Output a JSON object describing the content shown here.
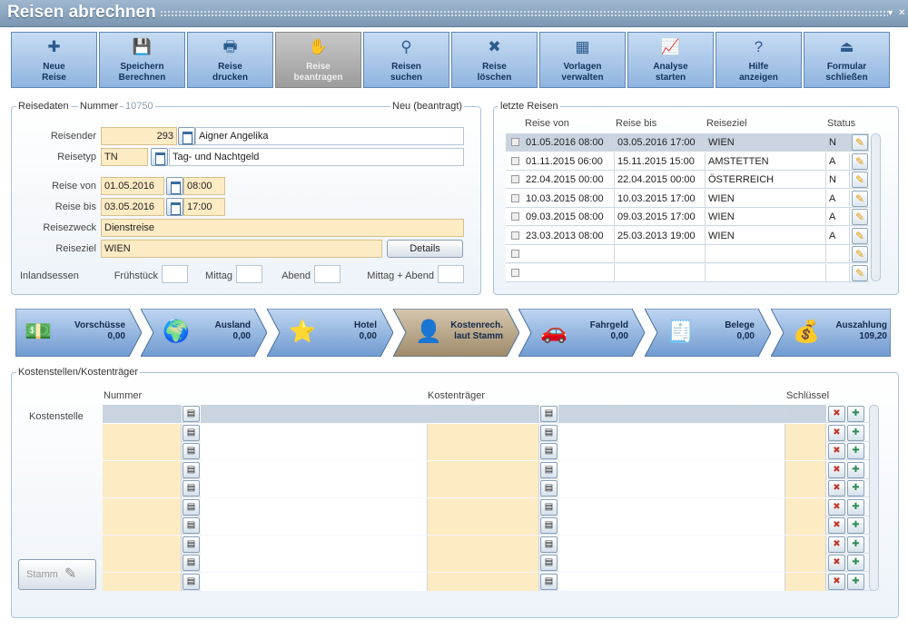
{
  "window": {
    "title": "Reisen abrechnen",
    "min_icon": "minimize-icon",
    "close_icon": "close-icon"
  },
  "toolbar": [
    {
      "label": "Neue\nReise",
      "icon": "new-trip-icon",
      "glyph": "✚",
      "disabled": false
    },
    {
      "label": "Speichern\nBerechnen",
      "icon": "save-icon",
      "glyph": "💾",
      "disabled": false
    },
    {
      "label": "Reise\ndrucken",
      "icon": "printer-icon",
      "glyph": "🖶",
      "disabled": false
    },
    {
      "label": "Reise\nbeantragen",
      "icon": "hand-icon",
      "glyph": "✋",
      "disabled": true
    },
    {
      "label": "Reisen\nsuchen",
      "icon": "binoculars-icon",
      "glyph": "⚲",
      "disabled": false
    },
    {
      "label": "Reise\nlöschen",
      "icon": "delete-icon",
      "glyph": "✖",
      "disabled": false
    },
    {
      "label": "Vorlagen\nverwalten",
      "icon": "templates-icon",
      "glyph": "▦",
      "disabled": false
    },
    {
      "label": "Analyse\nstarten",
      "icon": "analysis-icon",
      "glyph": "📈",
      "disabled": false
    },
    {
      "label": "Hilfe\nanzeigen",
      "icon": "help-icon",
      "glyph": "?",
      "disabled": false
    },
    {
      "label": "Formular\nschließen",
      "icon": "exit-icon",
      "glyph": "⏏",
      "disabled": false
    }
  ],
  "reisedaten": {
    "legend": "Reisedaten",
    "nummer_label": "Nummer",
    "nummer": "10750",
    "status": "Neu (beantragt)",
    "reisender_label": "Reisender",
    "reisender_nr": "293",
    "reisender_name": "Aigner Angelika",
    "reisetyp_label": "Reisetyp",
    "reisetyp_code": "TN",
    "reisetyp_name": "Tag- und Nachtgeld",
    "von_label": "Reise von",
    "von_datum": "01.05.2016",
    "von_zeit": "08:00",
    "bis_label": "Reise bis",
    "bis_datum": "03.05.2016",
    "bis_zeit": "17:00",
    "zweck_label": "Reisezweck",
    "zweck": "Dienstreise",
    "ziel_label": "Reiseziel",
    "ziel": "WIEN",
    "details": "Details",
    "essen_label": "Inlandsessen",
    "fruehstueck": "Frühstück",
    "mittag": "Mittag",
    "abend": "Abend",
    "mittag_abend": "Mittag + Abend"
  },
  "letzte_reisen": {
    "legend": "letzte Reisen",
    "headers": [
      "Reise von",
      "Reise bis",
      "Reiseziel",
      "Status"
    ],
    "rows": [
      {
        "von": "01.05.2016 08:00",
        "bis": "03.05.2016 17:00",
        "ziel": "WIEN",
        "status": "N"
      },
      {
        "von": "01.11.2015 06:00",
        "bis": "15.11.2015 15:00",
        "ziel": "AMSTETTEN",
        "status": "A"
      },
      {
        "von": "22.04.2015 00:00",
        "bis": "22.04.2015 00:00",
        "ziel": "ÖSTERREICH",
        "status": "N"
      },
      {
        "von": "10.03.2015 08:00",
        "bis": "10.03.2015 17:00",
        "ziel": "WIEN",
        "status": "A"
      },
      {
        "von": "09.03.2015 08:00",
        "bis": "09.03.2015 17:00",
        "ziel": "WIEN",
        "status": "A"
      },
      {
        "von": "23.03.2013 08:00",
        "bis": "25.03.2013 19:00",
        "ziel": "WIEN",
        "status": "A"
      },
      {
        "von": "",
        "bis": "",
        "ziel": "",
        "status": ""
      },
      {
        "von": "",
        "bis": "",
        "ziel": "",
        "status": ""
      }
    ]
  },
  "steps": [
    {
      "title": "Vorschüsse",
      "value": "0,00",
      "icon": "cash-icon",
      "glyph": "💵",
      "active": false
    },
    {
      "title": "Ausland",
      "value": "0,00",
      "icon": "globe-icon",
      "glyph": "🌍",
      "active": false
    },
    {
      "title": "Hotel",
      "value": "0,00",
      "icon": "hotel-stars-icon",
      "glyph": "⭐",
      "active": false
    },
    {
      "title": "Kostenrech.\nlaut Stamm",
      "value": "",
      "icon": "person-icon",
      "glyph": "👤",
      "active": true
    },
    {
      "title": "Fahrgeld",
      "value": "0,00",
      "icon": "car-icon",
      "glyph": "🚗",
      "active": false
    },
    {
      "title": "Belege",
      "value": "0,00",
      "icon": "receipt-icon",
      "glyph": "🧾",
      "active": false
    },
    {
      "title": "Auszahlung",
      "value": "109,20",
      "icon": "payout-icon",
      "glyph": "💰",
      "active": false
    }
  ],
  "kosten": {
    "legend": "Kostenstellen/Kostenträger",
    "nummer": "Nummer",
    "kostentraeger": "Kostenträger",
    "schluessel": "Schlüssel",
    "kostenstelle": "Kostenstelle",
    "stamm": "Stamm",
    "rows": 10
  }
}
